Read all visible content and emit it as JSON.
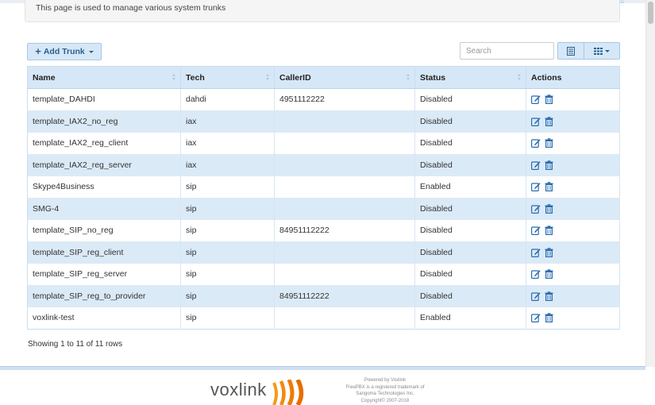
{
  "header": {
    "description": "This page is used to manage various system trunks"
  },
  "toolbar": {
    "add_trunk_label": "Add Trunk",
    "search_placeholder": "Search"
  },
  "table": {
    "columns": [
      "Name",
      "Tech",
      "CallerID",
      "Status",
      "Actions"
    ],
    "rows": [
      {
        "name": "template_DAHDI",
        "tech": "dahdi",
        "callerid": "4951112222",
        "status": "Disabled"
      },
      {
        "name": "template_IAX2_no_reg",
        "tech": "iax",
        "callerid": "",
        "status": "Disabled"
      },
      {
        "name": "template_IAX2_reg_client",
        "tech": "iax",
        "callerid": "",
        "status": "Disabled"
      },
      {
        "name": "template_IAX2_reg_server",
        "tech": "iax",
        "callerid": "",
        "status": "Disabled"
      },
      {
        "name": "Skype4Business",
        "tech": "sip",
        "callerid": "",
        "status": "Enabled"
      },
      {
        "name": "SMG-4",
        "tech": "sip",
        "callerid": "",
        "status": "Disabled"
      },
      {
        "name": "template_SIP_no_reg",
        "tech": "sip",
        "callerid": "84951112222",
        "status": "Disabled"
      },
      {
        "name": "template_SIP_reg_client",
        "tech": "sip",
        "callerid": "",
        "status": "Disabled"
      },
      {
        "name": "template_SIP_reg_server",
        "tech": "sip",
        "callerid": "",
        "status": "Disabled"
      },
      {
        "name": "template_SIP_reg_to_provider",
        "tech": "sip",
        "callerid": "84951112222",
        "status": "Disabled"
      },
      {
        "name": "voxlink-test",
        "tech": "sip",
        "callerid": "",
        "status": "Enabled"
      }
    ],
    "row_icons": [
      "edit-icon",
      "trash-icon"
    ]
  },
  "pagination": {
    "info": "Showing 1 to 11 of 11 rows"
  },
  "footer": {
    "logo_text": "voxlink",
    "lines": [
      "Powered by Voxlink",
      "FreePBX is a registered trademark of",
      "Sangoma Technologies Inc.",
      "Copyright© 2007-2018"
    ]
  },
  "colors": {
    "accent": "#2b6cb0",
    "header_bg": "#d6e8f7",
    "striped_row": "#dbeaf7",
    "logo_orange": "#f07d00"
  }
}
